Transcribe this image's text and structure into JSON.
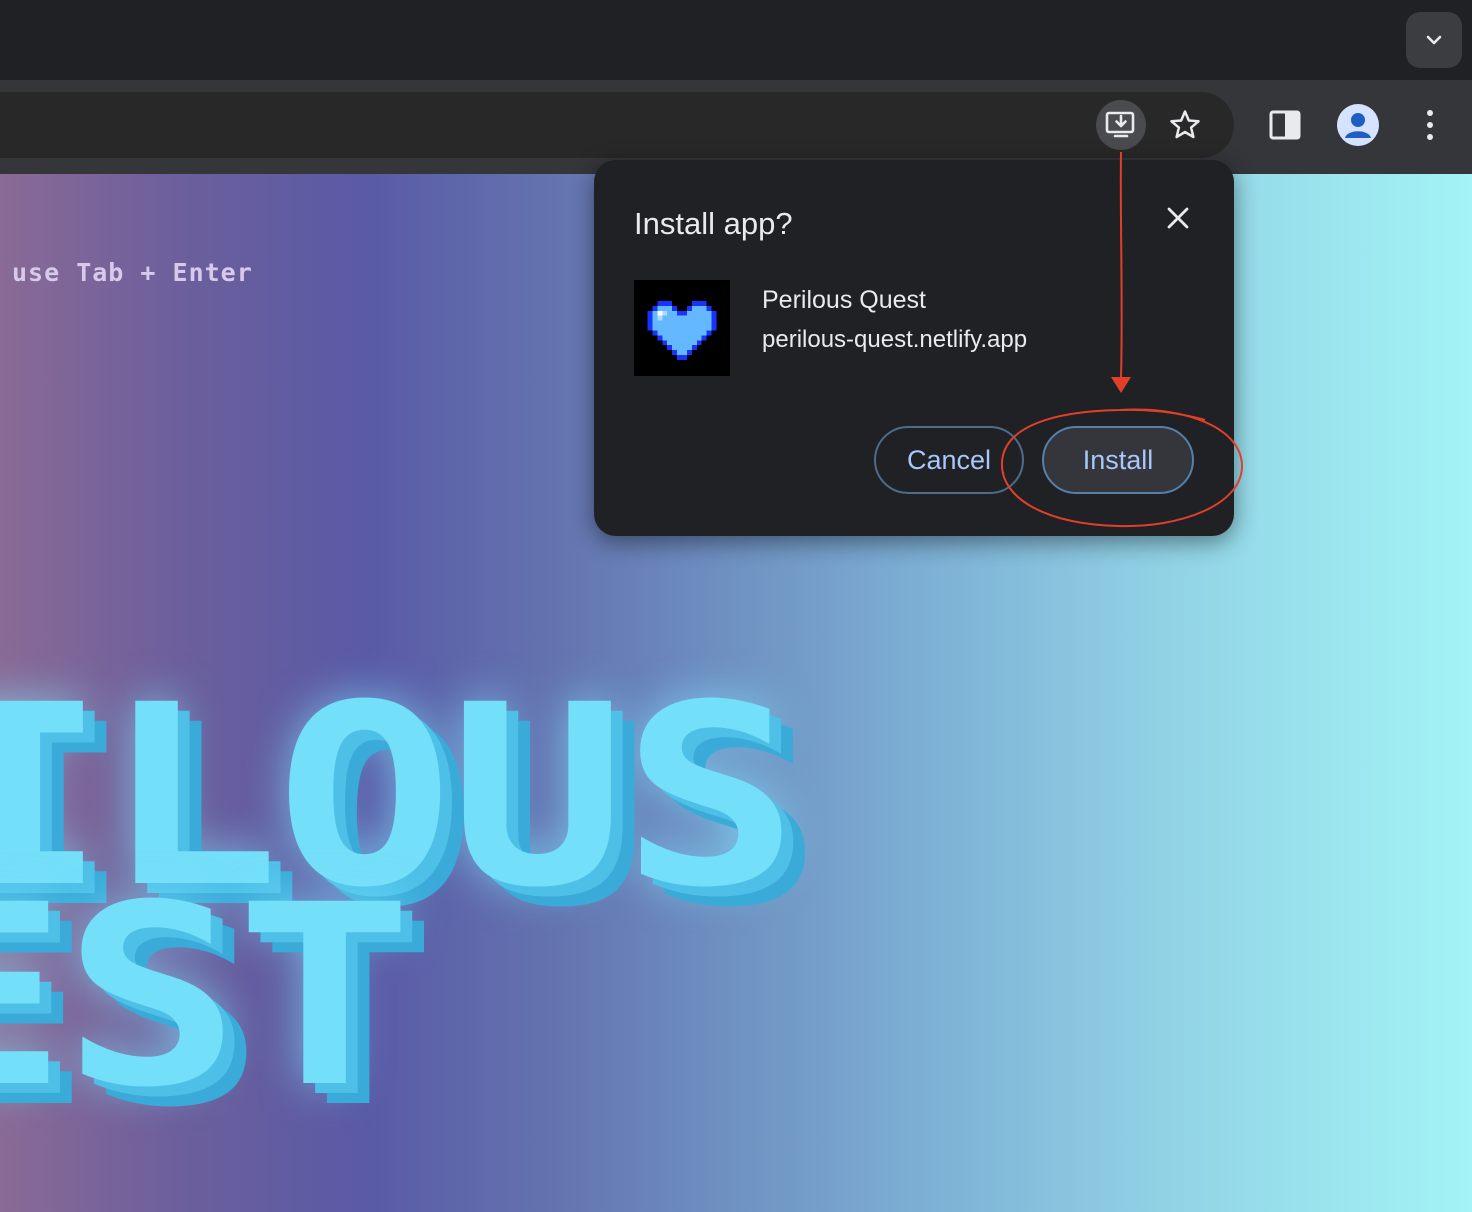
{
  "browser": {
    "toolbar_icons": [
      "install-app-icon",
      "bookmark-star-icon",
      "side-panel-icon",
      "profile-avatar-icon",
      "kebab-menu-icon"
    ],
    "tab_search_icon": "chevron-down-icon"
  },
  "page": {
    "hint": "use Tab + Enter",
    "title_line1": "ILOUS",
    "title_line2": "EST"
  },
  "dialog": {
    "title": "Install app?",
    "app_name": "Perilous Quest",
    "app_url": "perilous-quest.netlify.app",
    "cancel_label": "Cancel",
    "install_label": "Install",
    "icon": "pixel-heart-icon"
  },
  "colors": {
    "accent_text": "#a8c7fa",
    "annotation_red": "#e0402a",
    "title_cyan": "#74dff9"
  }
}
